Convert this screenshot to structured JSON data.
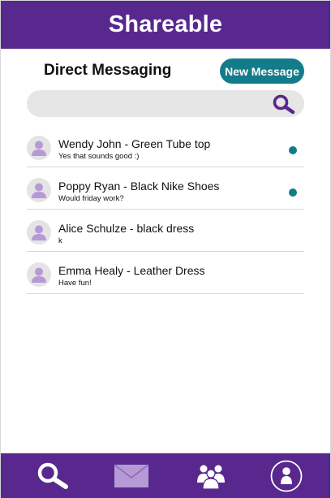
{
  "header": {
    "app_title": "Shareable"
  },
  "main": {
    "page_title": "Direct Messaging",
    "new_message_label": "New Message",
    "search": {
      "value": "",
      "placeholder": ""
    }
  },
  "conversations": [
    {
      "title": "Wendy John - Green Tube top",
      "preview": "Yes that sounds good :)",
      "unread": true
    },
    {
      "title": "Poppy Ryan - Black Nike Shoes",
      "preview": "Would friday work?",
      "unread": true
    },
    {
      "title": "Alice Schulze - black dress",
      "preview": "k",
      "unread": false
    },
    {
      "title": "Emma Healy - Leather Dress",
      "preview": "Have fun!",
      "unread": false
    }
  ],
  "nav": [
    {
      "icon": "search-icon"
    },
    {
      "icon": "mail-icon"
    },
    {
      "icon": "community-icon"
    },
    {
      "icon": "profile-icon"
    }
  ],
  "colors": {
    "brand_purple": "#58288e",
    "accent_teal": "#137c8a",
    "icon_lavender": "#b69ad6",
    "search_bg": "#e6e6e6"
  }
}
